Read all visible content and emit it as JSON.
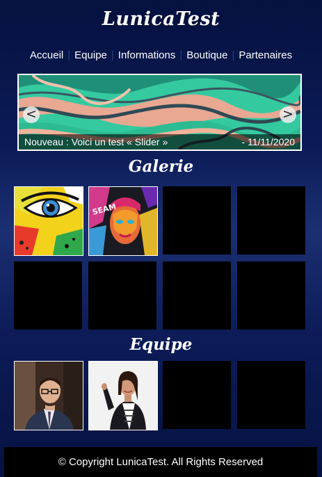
{
  "site": {
    "logo": "LunicaTest"
  },
  "nav": {
    "items": [
      "Accueil",
      "Equipe",
      "Informations",
      "Boutique",
      "Partenaires"
    ]
  },
  "slider": {
    "caption": "Nouveau : Voici un test « Slider »",
    "date": "- 11/11/2020",
    "prev_label": "<",
    "next_label": ">"
  },
  "gallery": {
    "title": "Galerie"
  },
  "team": {
    "title": "Equipe"
  },
  "footer": {
    "text": "© Copyright LunicaTest. All Rights Reserved"
  }
}
